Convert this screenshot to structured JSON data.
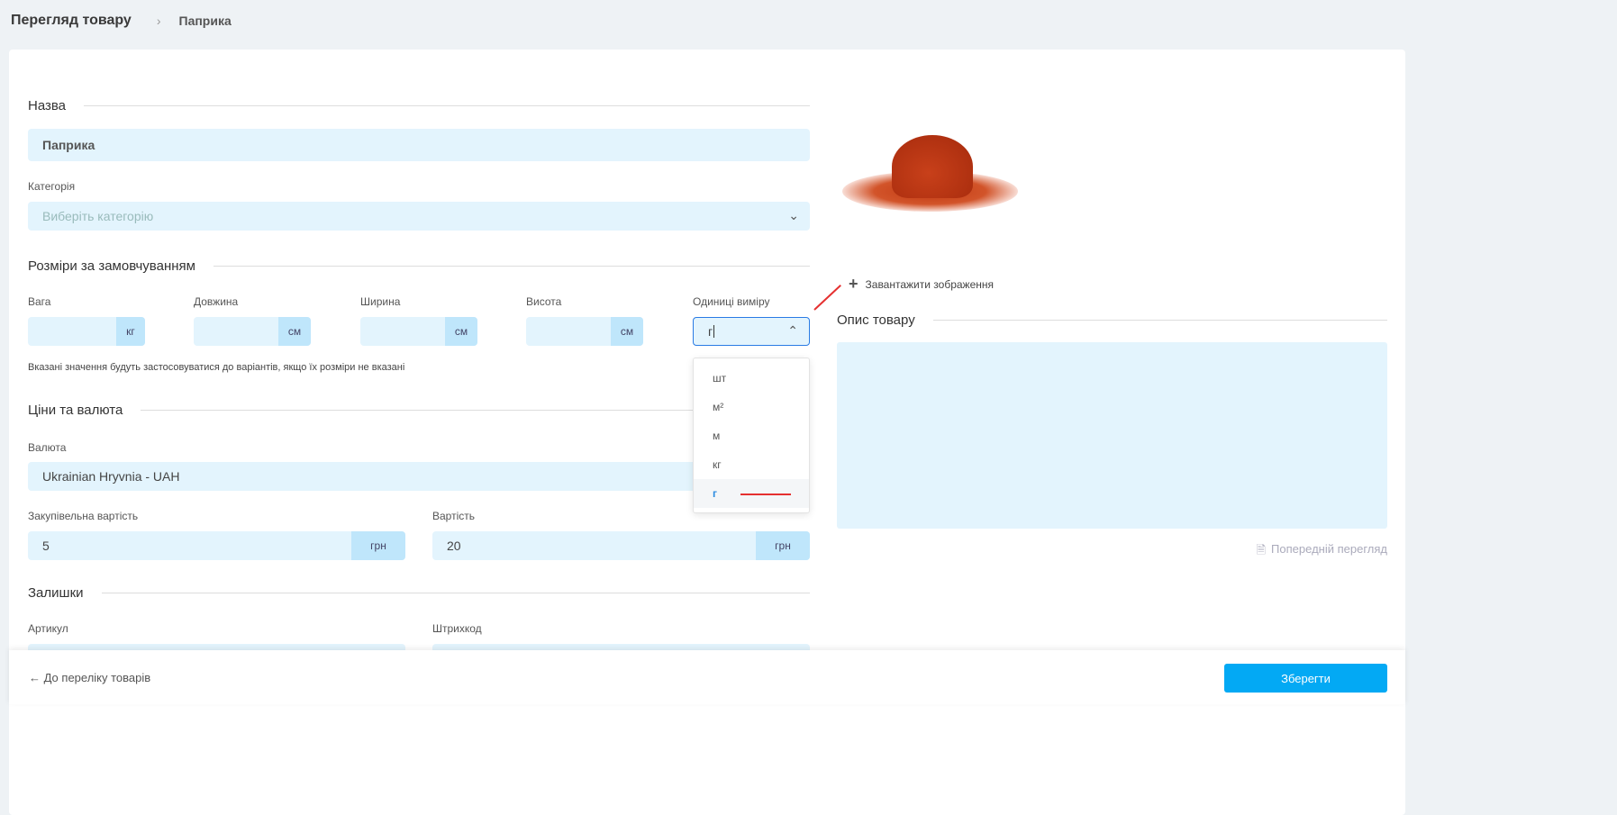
{
  "breadcrumb": {
    "title": "Перегляд товару",
    "current": "Паприка"
  },
  "name": {
    "label": "Назва",
    "value": "Паприка"
  },
  "category": {
    "label": "Категорія",
    "placeholder": "Виберіть категорію"
  },
  "sizes": {
    "title": "Розміри за замовчуванням",
    "weight": {
      "label": "Вага",
      "unit": "кг"
    },
    "length": {
      "label": "Довжина",
      "unit": "см"
    },
    "width": {
      "label": "Ширина",
      "unit": "см"
    },
    "height": {
      "label": "Висота",
      "unit": "см"
    },
    "units": {
      "label": "Одиниці виміру",
      "value": "г",
      "options": [
        "шт",
        "м²",
        "м",
        "кг",
        "г"
      ]
    },
    "hint": "Вказані значення будуть застосовуватися до варіантів, якщо їх розміри не вказані"
  },
  "prices": {
    "title": "Ціни та валюта",
    "currency_label": "Валюта",
    "currency": "Ukrainian Hryvnia - UAH",
    "purchase_label": "Закупівельна вартість",
    "purchase": "5",
    "price_label": "Вартість",
    "price": "20",
    "unit": "грн"
  },
  "stock": {
    "title": "Залишки",
    "sku_label": "Артикул",
    "barcode_label": "Штрихкод"
  },
  "image": {
    "upload": "Завантажити зображення"
  },
  "description": {
    "title": "Опис товару",
    "preview": "Попередній перегляд"
  },
  "footer": {
    "back": "← До переліку товарів",
    "save": "Зберегти"
  }
}
